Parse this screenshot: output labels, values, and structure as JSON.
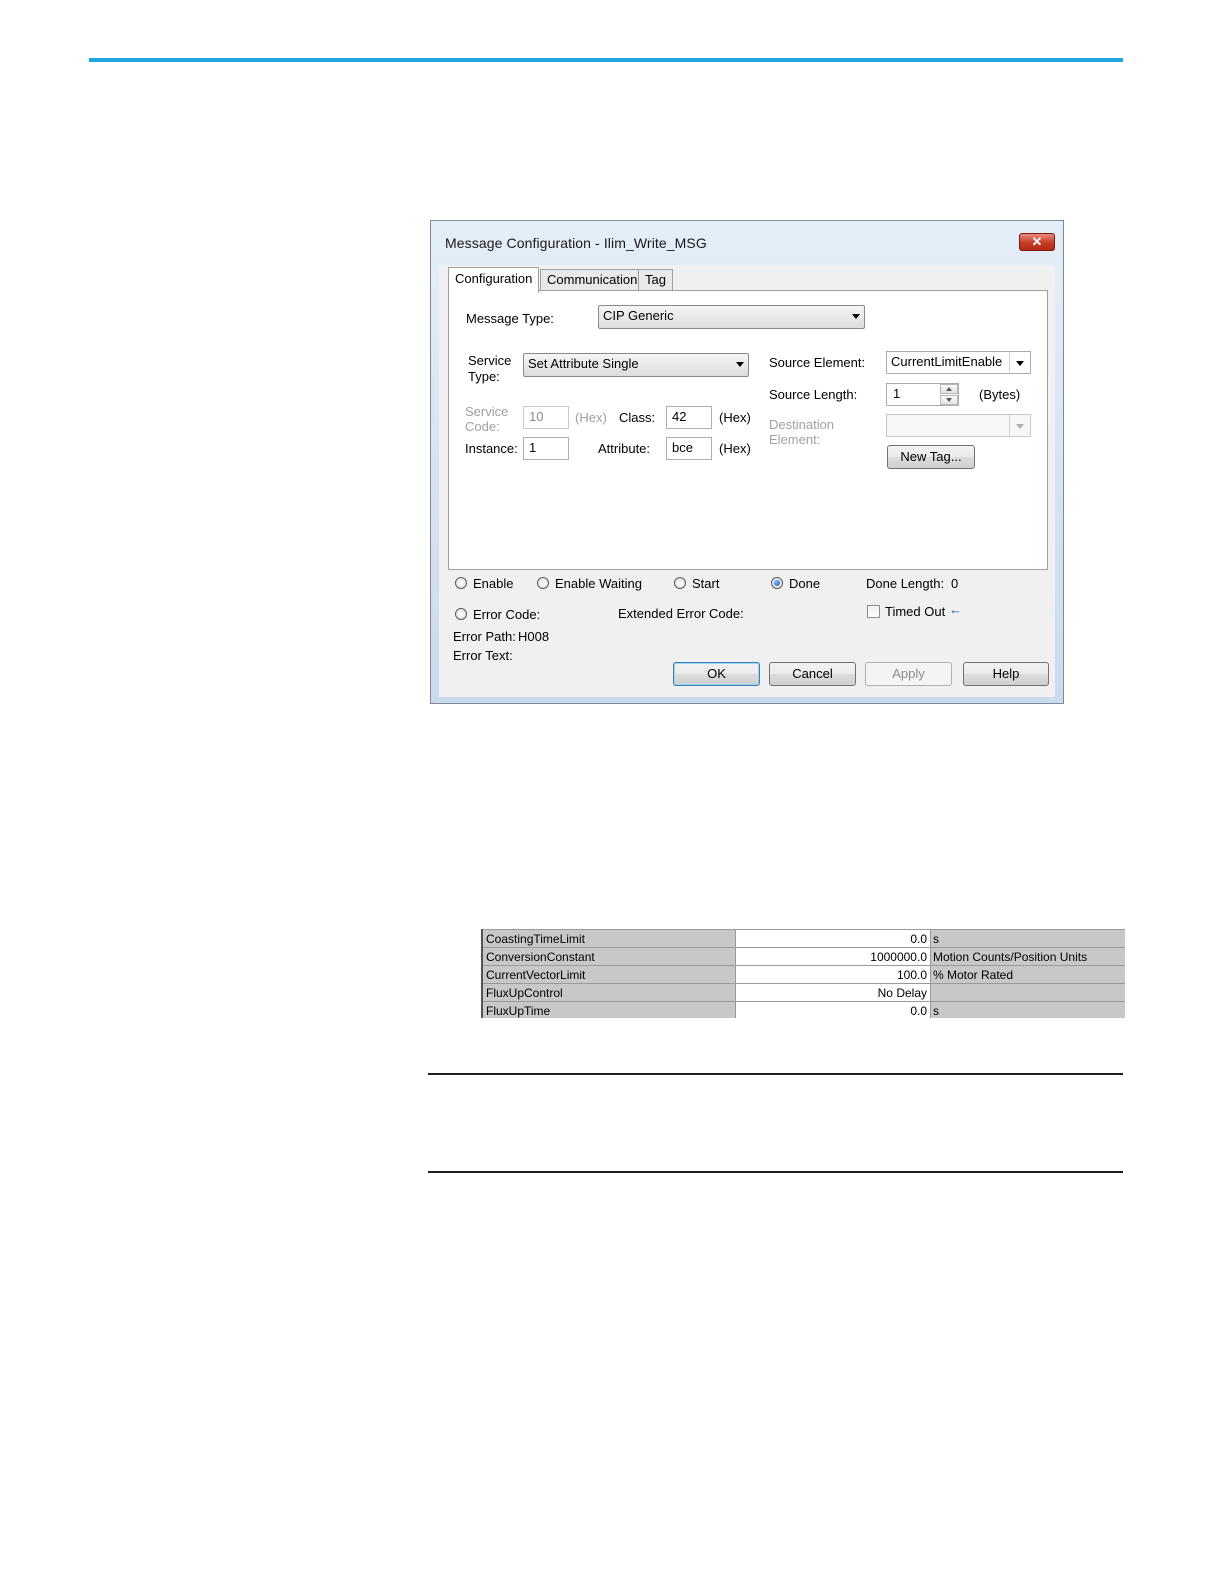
{
  "dialog": {
    "title": "Message Configuration - Ilim_Write_MSG",
    "close_label": "✕",
    "tabs": [
      {
        "label": "Configuration",
        "active": true
      },
      {
        "label": "Communication",
        "active": false
      },
      {
        "label": "Tag",
        "active": false
      }
    ],
    "message_type": {
      "label": "Message Type:",
      "value": "CIP Generic"
    },
    "service_type": {
      "label_line1": "Service",
      "label_line2": "Type:",
      "value": "Set Attribute Single"
    },
    "service_code": {
      "label_line1": "Service",
      "label_line2": "Code:",
      "value": "10",
      "unit": "(Hex)"
    },
    "class": {
      "label": "Class:",
      "value": "42",
      "unit": "(Hex)"
    },
    "instance": {
      "label": "Instance:",
      "value": "1"
    },
    "attribute": {
      "label": "Attribute:",
      "value": "bce",
      "unit": "(Hex)"
    },
    "source_element": {
      "label": "Source Element:",
      "value": "CurrentLimitEnable"
    },
    "source_length": {
      "label": "Source Length:",
      "value": "1",
      "unit": "(Bytes)"
    },
    "destination_element": {
      "label_line1": "Destination",
      "label_line2": "Element:",
      "value": ""
    },
    "new_tag_label": "New Tag...",
    "status": {
      "enable_label": "Enable",
      "enable_waiting_label": "Enable Waiting",
      "start_label": "Start",
      "done_label": "Done",
      "done_checked": true,
      "done_length_label": "Done Length:",
      "done_length_value": "0",
      "error_code_label": "Error Code:",
      "extended_error_code_label": "Extended Error Code:",
      "timed_out_label": "Timed Out",
      "timed_out_arrow": "←",
      "error_path_label": "Error Path:",
      "error_path_value": "H008",
      "error_text_label": "Error Text:"
    },
    "buttons": {
      "ok": "OK",
      "cancel": "Cancel",
      "apply": "Apply",
      "help": "Help"
    }
  },
  "parameters": [
    {
      "name": "CoastingTimeLimit",
      "value": "0.0",
      "unit": "s"
    },
    {
      "name": "ConversionConstant",
      "value": "1000000.0",
      "unit": "Motion Counts/Position Units"
    },
    {
      "name": "CurrentVectorLimit",
      "value": "100.0",
      "unit": "% Motor Rated"
    },
    {
      "name": "FluxUpControl",
      "value": "No Delay",
      "unit": ""
    },
    {
      "name": "FluxUpTime",
      "value": "0.0",
      "unit": "s"
    }
  ],
  "colors": {
    "accent_rule": "#1ba8e0",
    "close_button": "#c63d26"
  }
}
